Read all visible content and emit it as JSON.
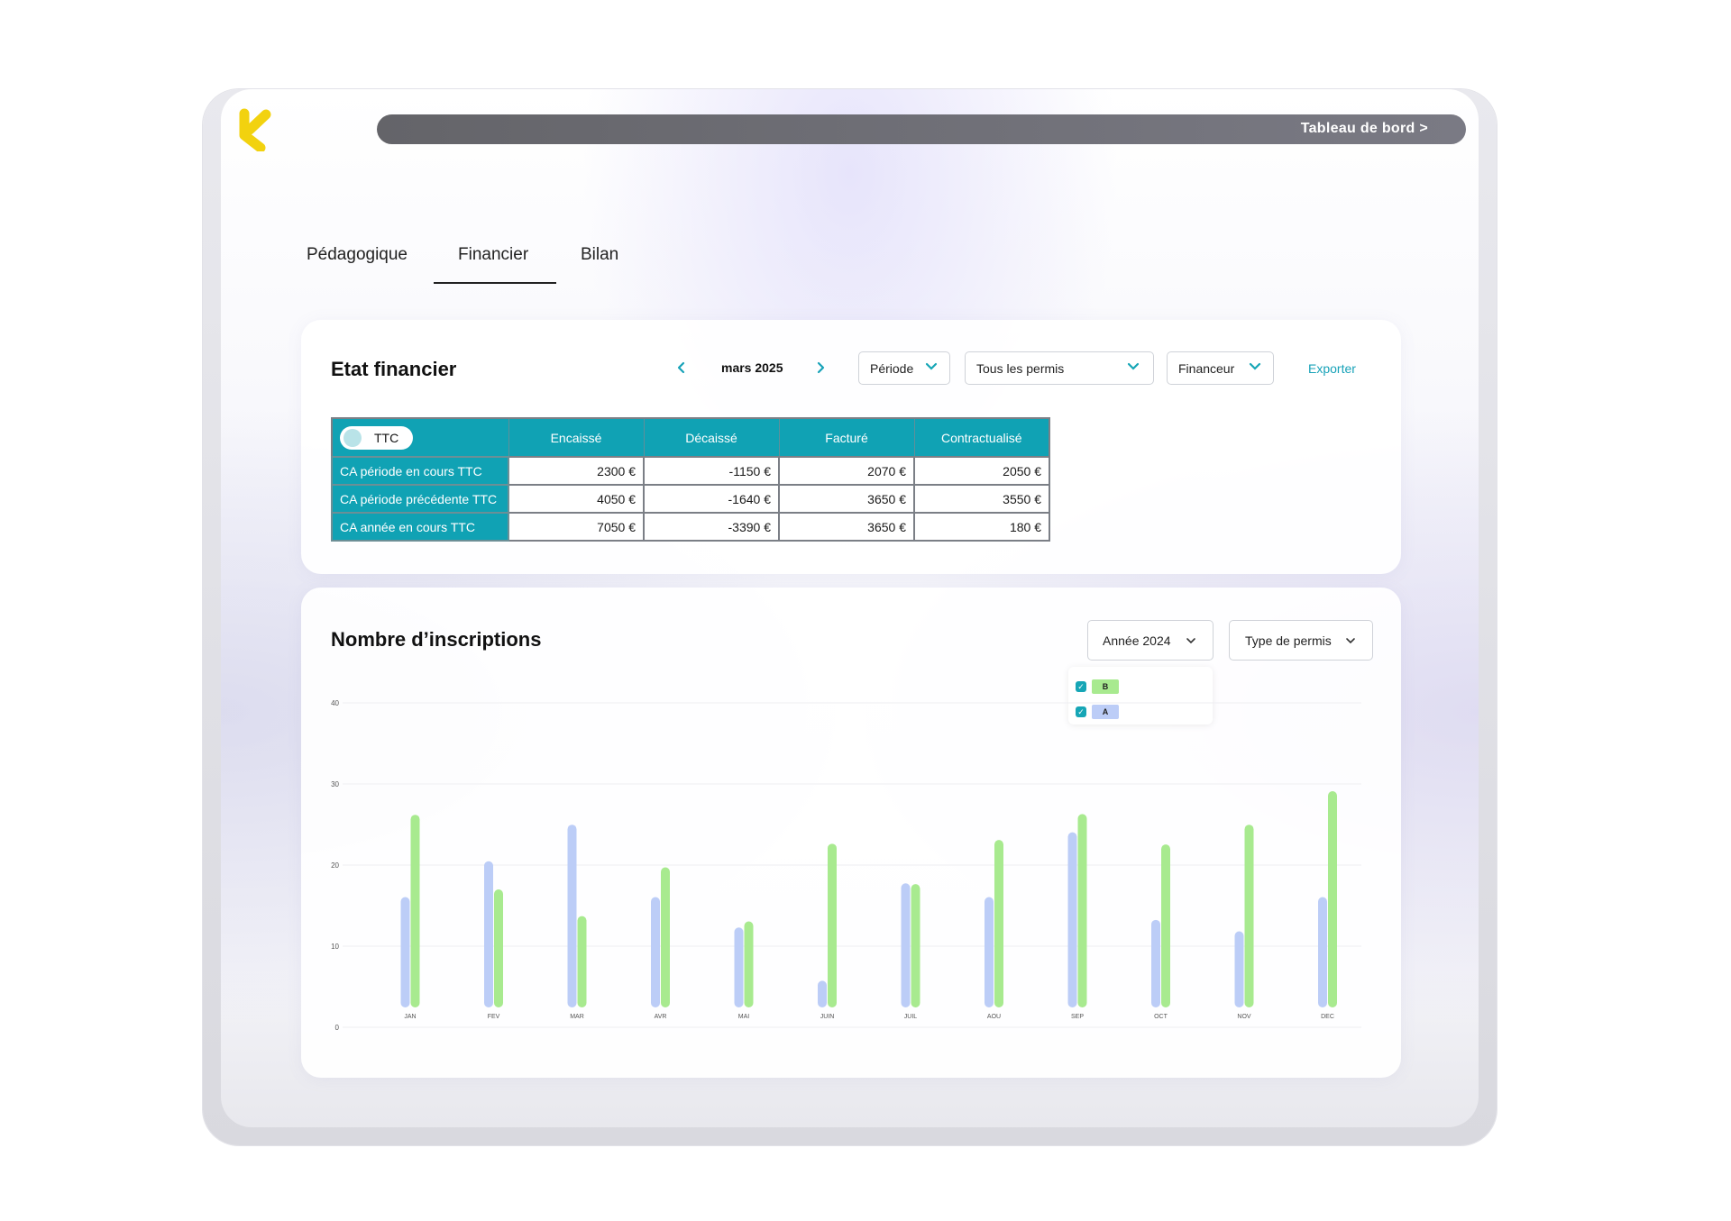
{
  "header": {
    "dashboard_link": "Tableau de bord >"
  },
  "tabs": [
    {
      "label": "Pédagogique"
    },
    {
      "label": "Financier"
    },
    {
      "label": "Bilan"
    }
  ],
  "financial": {
    "title": "Etat financier",
    "period_label": "mars 2025",
    "filters": {
      "periode": "Période",
      "permis": "Tous les permis",
      "financeur": "Financeur"
    },
    "export_label": "Exporter",
    "toggle_label": "TTC",
    "columns": [
      "Encaissé",
      "Décaissé",
      "Facturé",
      "Contractualisé"
    ],
    "rows": [
      {
        "label": "CA période en cours TTC",
        "values": [
          "2300 €",
          "-1150 €",
          "2070 €",
          "2050 €"
        ]
      },
      {
        "label": "CA période précédente TTC",
        "values": [
          "4050 €",
          "-1640 €",
          "3650 €",
          "3550 €"
        ]
      },
      {
        "label": "CA année en cours TTC",
        "values": [
          "7050 €",
          "-3390 €",
          "3650 €",
          "180 €"
        ]
      }
    ]
  },
  "inscriptions": {
    "title": "Nombre d’inscriptions",
    "filters": {
      "year": "Année 2024",
      "permis_type": "Type de permis"
    }
  },
  "colors": {
    "accent": "#10a2b4",
    "series_a": "#bccdf7",
    "series_b": "#a8ea8f"
  },
  "chart_data": {
    "type": "bar",
    "categories": [
      "JAN",
      "FEV",
      "MAR",
      "AVR",
      "MAI",
      "JUIN",
      "JUIL",
      "AOU",
      "SEP",
      "OCT",
      "NOV",
      "DEC"
    ],
    "series": [
      {
        "name": "A",
        "values": [
          14.5,
          19.2,
          24,
          14.5,
          10.5,
          3.5,
          16.3,
          14.5,
          23,
          11.5,
          10,
          14.5
        ]
      },
      {
        "name": "B",
        "values": [
          25.3,
          15.5,
          12,
          18.4,
          11.3,
          21.5,
          16.2,
          22,
          25.4,
          21.4,
          24,
          28.4
        ]
      }
    ],
    "yticks": [
      "0",
      "10",
      "20",
      "30",
      "40"
    ],
    "ylim": [
      0,
      40
    ],
    "legend": [
      "B",
      "A"
    ],
    "grid": true
  }
}
